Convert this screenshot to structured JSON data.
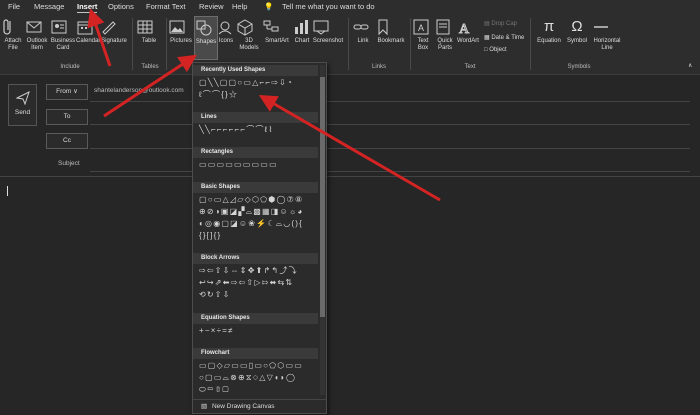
{
  "menu": {
    "tabs": [
      "File",
      "Message",
      "Insert",
      "Options",
      "Format Text",
      "Review",
      "Help"
    ],
    "active": "Insert",
    "tell_me": "Tell me what you want to do"
  },
  "ribbon": {
    "include": {
      "label": "Include",
      "attach": "Attach File",
      "outlook_item": "Outlook Item",
      "business_card": "Business Card",
      "calendar": "Calendar",
      "signature": "Signature"
    },
    "tables": {
      "label": "Tables",
      "table": "Table"
    },
    "illustrations": {
      "pictures": "Pictures",
      "shapes": "Shapes",
      "icons": "Icons",
      "models": "3D Models",
      "smartart": "SmartArt",
      "chart": "Chart",
      "screenshot": "Screenshot"
    },
    "links": {
      "label": "Links",
      "link": "Link",
      "bookmark": "Bookmark"
    },
    "text": {
      "label": "Text",
      "text_box": "Text Box",
      "quick_parts": "Quick Parts",
      "wordart": "WordArt",
      "drop_cap": "Drop Cap",
      "date_time": "Date & Time",
      "object": "Object"
    },
    "symbols": {
      "label": "Symbols",
      "equation": "Equation",
      "symbol": "Symbol",
      "horizontal_line": "Horizontal Line"
    }
  },
  "compose": {
    "send": "Send",
    "from": "From",
    "from_value": "shantelanderson@outlook.com",
    "to": "To",
    "cc": "Cc",
    "subject": "Subject"
  },
  "shapes_menu": {
    "sections": [
      "Recently Used Shapes",
      "Lines",
      "Rectangles",
      "Basic Shapes",
      "Block Arrows",
      "Equation Shapes",
      "Flowchart"
    ],
    "recent_row1": "▢╲╲▢▢○▭△⌐⌐⇨⇩◔",
    "recent_row2": "ℓ⌒⌒{}☆",
    "lines_row": "╲╲⌐⌐⌐⌐⌐⌐⌒⌒ℓ⌇",
    "rect_row": "▭▭▭▭▭▭▭▭▭",
    "basic_row1": "▢○▭△◿▱◇⬡⬠⬢◯⑦⑧",
    "basic_row2": "⊕⊘◑▣◪▞⌓▩▦◨☺☼◕",
    "basic_row3": "◐◎◉▢◪☺❀⚡☾⌓◡(){",
    "basic_row4": "{}[]{}",
    "block_row1": "⇨⇦⇧⇩⇔⇕✥⬆↱↰⤴⤵",
    "block_row2": "↩↪⇗⬅⇨⇦⇧▷⇰⬌⇆⇅",
    "block_row3": "⟲↻⇧⇩",
    "eq_row": "+−×÷=≠",
    "flow_row1": "▭▢◇▱▭▭▯▭○⬠⬡▭▭",
    "flow_row2": "○▢▭⌓⊗⊕⧖⬦△▽◖◗◯",
    "flow_row3": "⬭▭▯▢",
    "new_canvas": "New Drawing Canvas"
  }
}
